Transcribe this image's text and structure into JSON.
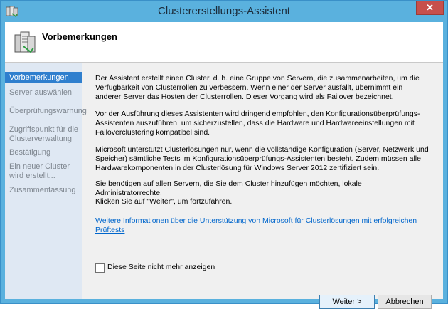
{
  "window": {
    "title": "Clustererstellungs-Assistent",
    "close_label": "✕"
  },
  "header": {
    "title": "Vorbemerkungen"
  },
  "sidebar": {
    "items": [
      {
        "label": "Vorbemerkungen",
        "active": true
      },
      {
        "label": "Server auswählen",
        "active": false
      },
      {
        "label": "Überprüfungswarnung",
        "active": false
      },
      {
        "label": "Zugriffspunkt für die Clusterverwaltung",
        "active": false
      },
      {
        "label": "Bestätigung",
        "active": false
      },
      {
        "label": "Ein neuer Cluster wird erstellt...",
        "active": false
      },
      {
        "label": "Zusammenfassung",
        "active": false
      }
    ]
  },
  "main": {
    "paragraphs": [
      "Der Assistent erstellt einen Cluster, d. h. eine Gruppe von Servern, die zusammenarbeiten, um die Verfügbarkeit von Clusterrollen zu verbessern. Wenn einer der Server ausfällt, übernimmt ein anderer Server das Hosten der Clusterrollen. Dieser Vorgang wird als Failover bezeichnet.",
      "Vor der Ausführung dieses Assistenten wird dringend empfohlen, den Konfigurationsüberprüfungs-Assistenten auszuführen, um sicherzustellen, dass die Hardware und Hardwareeinstellungen mit Failoverclustering kompatibel sind.",
      "Microsoft unterstützt Clusterlösungen nur, wenn die vollständige Konfiguration (Server, Netzwerk und Speicher) sämtliche Tests im Konfigurationsüberprüfungs-Assistenten besteht. Zudem müssen alle Hardwarekomponenten in der Clusterlösung für Windows Server 2012 zertifiziert sein.",
      "Sie benötigen auf allen Servern, die Sie dem Cluster hinzufügen möchten, lokale Administratorrechte.",
      "Klicken Sie auf \"Weiter\", um fortzufahren."
    ],
    "link_text": "Weitere Informationen über die Unterstützung von Microsoft für Clusterlösungen mit erfolgreichen Prüftests",
    "checkbox_label": "Diese Seite nicht mehr anzeigen",
    "checkbox_checked": false
  },
  "buttons": {
    "next_label": "Weiter >",
    "cancel_label": "Abbrechen"
  },
  "colors": {
    "titlebar": "#5ab1de",
    "active_nav": "#2f7fce",
    "sidebar": "#dfe8f3",
    "link": "#0066cc"
  }
}
